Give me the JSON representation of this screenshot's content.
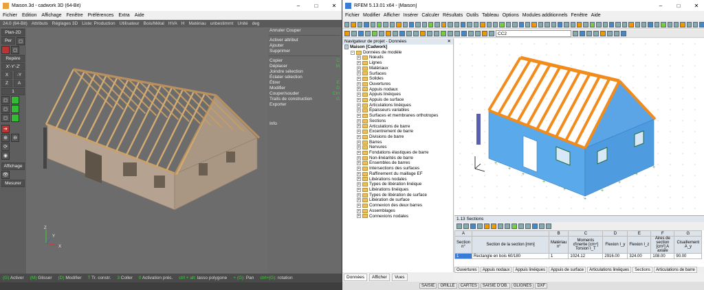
{
  "cadwork": {
    "title": "Maison.3d - cadwork 3D (64-Bit)",
    "menu": [
      "Fichier",
      "Edition",
      "Affichage",
      "Fenêtre",
      "Préférences",
      "Extra",
      "Aide"
    ],
    "toolbar": [
      "24.0 (64-Bit)",
      "Attributs",
      "Réglages 3D",
      "Liste: Production",
      "Utilisateur",
      "Bois/Métal",
      "HVA",
      "H",
      "Matériau",
      "unbestimmt",
      "Unité",
      "deg"
    ],
    "left": {
      "plan2d": "Plan-2D",
      "per": "Per",
      "repere": "Repère",
      "xyz": "X'-Y'-Z'",
      "x": "X",
      "mx": "-Y",
      "z": "Z",
      "a": "A",
      "one": "1",
      "affichage": "Affichage",
      "mesurer": "Mesurer"
    },
    "right_menu": [
      {
        "label": "Annuler Couper",
        "sc": ""
      },
      {
        "label": "",
        "sc": ""
      },
      {
        "label": "Activer attribut",
        "sc": ""
      },
      {
        "label": "Ajouter",
        "sc": ""
      },
      {
        "label": "Supprimer",
        "sc": ""
      },
      {
        "label": "",
        "sc": ""
      },
      {
        "label": "Copier",
        "sc": "C"
      },
      {
        "label": "Déplacer",
        "sc": "M"
      },
      {
        "label": "Joindre sélection",
        "sc": ""
      },
      {
        "label": "Éclater sélection",
        "sc": ""
      },
      {
        "label": "Étirer",
        "sc": "E"
      },
      {
        "label": "Modifier",
        "sc": "D"
      },
      {
        "label": "Couper/souder",
        "sc": "Ctrl"
      },
      {
        "label": "Traits de construction",
        "sc": "G"
      },
      {
        "label": "Exporter",
        "sc": ""
      }
    ],
    "info": "Info",
    "status": [
      {
        "k": "(G)",
        "t": "Activer"
      },
      {
        "k": "(M)",
        "t": "Glisser"
      },
      {
        "k": "(D)",
        "t": "Modifier"
      },
      {
        "k": "T",
        "t": "Tr. constr."
      },
      {
        "k": "3",
        "t": "Coller"
      },
      {
        "k": "0",
        "t": "Activation préc."
      },
      {
        "k": "ctrl + alt:",
        "t": "lasso polygone"
      },
      {
        "k": "+ (G):",
        "t": "Pan"
      },
      {
        "k": "ctrl+(G):",
        "t": "rotation"
      }
    ],
    "axes": {
      "x": "X",
      "y": "Y",
      "z": "Z"
    }
  },
  "rfem": {
    "title": "RFEM 5.13.01 x64 - [Maison]",
    "menu": [
      "Fichier",
      "Modifier",
      "Afficher",
      "Insérer",
      "Calculer",
      "Résultats",
      "Outils",
      "Tableau",
      "Options",
      "Modules additionnels",
      "Fenêtre",
      "Aide"
    ],
    "combo": "CC2",
    "nav_title": "Navigateur de projet - Données",
    "tree": [
      {
        "lvl": 0,
        "type": "doc",
        "label": "Maison [Cadwork]"
      },
      {
        "lvl": 1,
        "type": "fold",
        "label": "Données de modèle"
      },
      {
        "lvl": 2,
        "type": "fold",
        "label": "Nœuds"
      },
      {
        "lvl": 2,
        "type": "fold",
        "label": "Lignes"
      },
      {
        "lvl": 2,
        "type": "fold",
        "label": "Matériaux"
      },
      {
        "lvl": 2,
        "type": "fold",
        "label": "Surfaces"
      },
      {
        "lvl": 2,
        "type": "fold",
        "label": "Solides"
      },
      {
        "lvl": 2,
        "type": "fold",
        "label": "Ouvertures"
      },
      {
        "lvl": 2,
        "type": "fold",
        "label": "Appuis nodaux"
      },
      {
        "lvl": 2,
        "type": "fold",
        "label": "Appuis linéiques"
      },
      {
        "lvl": 2,
        "type": "fold",
        "label": "Appuis de surface"
      },
      {
        "lvl": 2,
        "type": "fold",
        "label": "Articulations linéiques"
      },
      {
        "lvl": 2,
        "type": "fold",
        "label": "Épaisseurs variables"
      },
      {
        "lvl": 2,
        "type": "fold",
        "label": "Surfaces et membranes orthotropes"
      },
      {
        "lvl": 2,
        "type": "fold",
        "label": "Sections"
      },
      {
        "lvl": 2,
        "type": "fold",
        "label": "Articulations de barre"
      },
      {
        "lvl": 2,
        "type": "fold",
        "label": "Excentrement de barre"
      },
      {
        "lvl": 2,
        "type": "fold",
        "label": "Divisions de barre"
      },
      {
        "lvl": 2,
        "type": "fold",
        "label": "Barres"
      },
      {
        "lvl": 2,
        "type": "fold",
        "label": "Nervures"
      },
      {
        "lvl": 2,
        "type": "fold",
        "label": "Fondations élastiques de barre"
      },
      {
        "lvl": 2,
        "type": "fold",
        "label": "Non-linéarités de barre"
      },
      {
        "lvl": 2,
        "type": "fold",
        "label": "Ensembles de barres"
      },
      {
        "lvl": 2,
        "type": "fold",
        "label": "Intersections des surfaces"
      },
      {
        "lvl": 2,
        "type": "fold",
        "label": "Raffinement du maillage EF"
      },
      {
        "lvl": 2,
        "type": "fold",
        "label": "Libérations nodales"
      },
      {
        "lvl": 2,
        "type": "fold",
        "label": "Types de libération linéique"
      },
      {
        "lvl": 2,
        "type": "fold",
        "label": "Libérations linéiques"
      },
      {
        "lvl": 2,
        "type": "fold",
        "label": "Types de libération de surface"
      },
      {
        "lvl": 2,
        "type": "fold",
        "label": "Libération de surface"
      },
      {
        "lvl": 2,
        "type": "fold",
        "label": "Connexion des deux barres"
      },
      {
        "lvl": 2,
        "type": "fold",
        "label": "Assemblages"
      },
      {
        "lvl": 2,
        "type": "fold",
        "label": "Connexions nodales"
      }
    ],
    "nav_tabs": [
      "Données",
      "Afficher",
      "Vues"
    ],
    "sections": {
      "title": "1.13 Sections",
      "col_letters": [
        "A",
        "B",
        "C",
        "D",
        "E",
        "F",
        "G"
      ],
      "headers": [
        "Section n°",
        "Section de la section [mm]",
        "Matériau n°",
        "Moments d'inertie [cm⁴] Torsion I_T",
        "Flexion I_y",
        "Flexion I_z",
        "Aires de section [cm²] A axiale",
        "Cisaillement A_y"
      ],
      "row": [
        "1",
        "Rectangle en bois 60/180",
        "1",
        "1024.12",
        "2916.00",
        "324.00",
        "108.00",
        "90.00"
      ]
    },
    "sect_tabs": [
      "Ouvertures",
      "Appuis nodaux",
      "Appuis linéiques",
      "Appuis de surface",
      "Articulations linéiques",
      "Sections",
      "Articulations de barre"
    ],
    "status": [
      "SAISIE",
      "GRILLE",
      "CARTES",
      "SAISIE D'OB.",
      "GLIGNES",
      "DXF"
    ]
  }
}
